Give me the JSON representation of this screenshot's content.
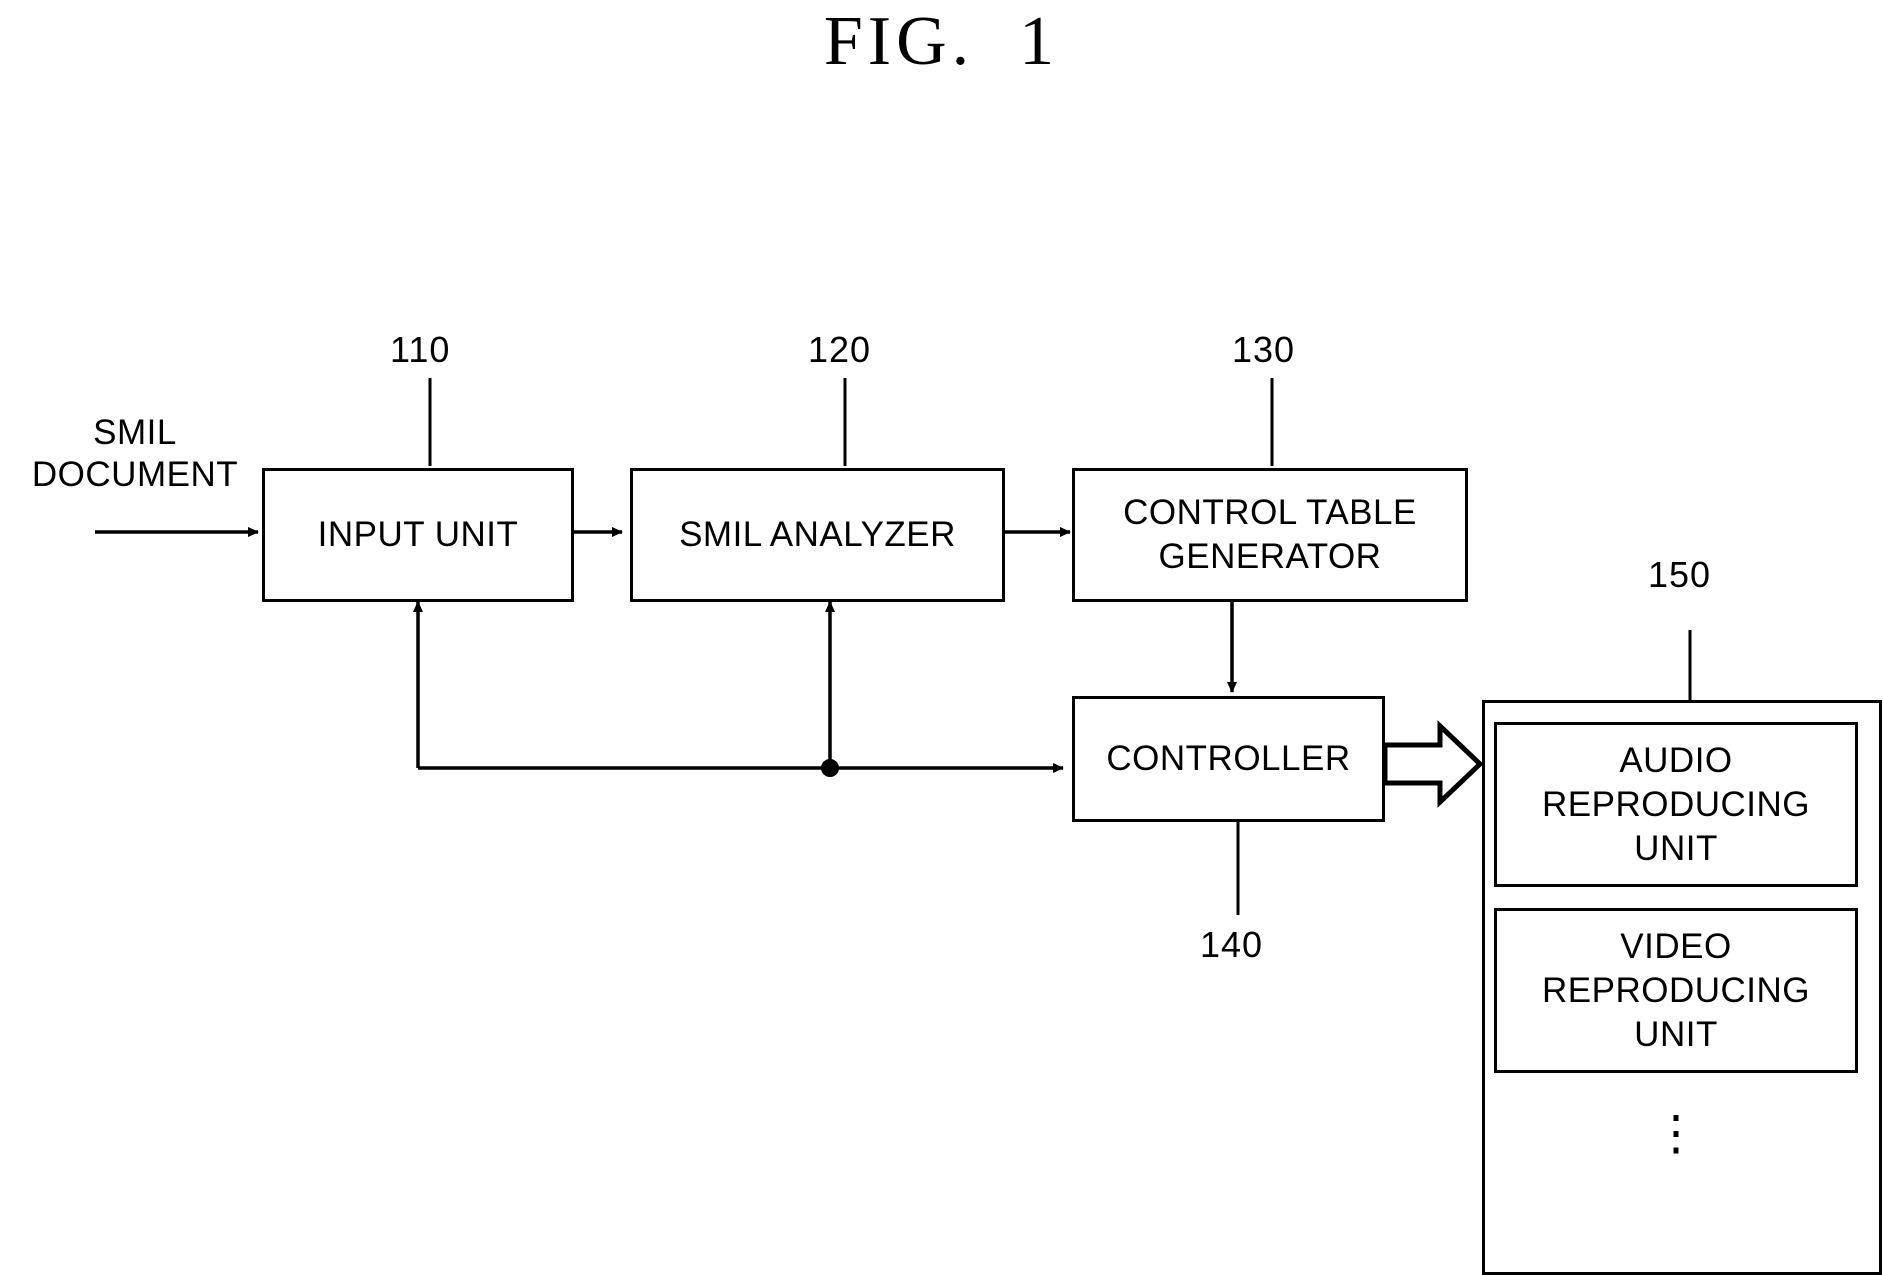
{
  "figure": {
    "title": "FIG.  1",
    "type": "patent-block-diagram"
  },
  "labels": {
    "input_source": "SMIL\nDOCUMENT"
  },
  "blocks": [
    {
      "id": "input-unit",
      "label": "INPUT UNIT",
      "ref": "110"
    },
    {
      "id": "smil-analyzer",
      "label": "SMIL ANALYZER",
      "ref": "120"
    },
    {
      "id": "control-table-gen",
      "label": "CONTROL TABLE\nGENERATOR",
      "ref": "130"
    },
    {
      "id": "controller",
      "label": "CONTROLLER",
      "ref": "140"
    },
    {
      "id": "reproducing-group",
      "label": "",
      "ref": "150"
    },
    {
      "id": "audio-unit",
      "label": "AUDIO\nREPRODUCING\nUNIT",
      "ref": ""
    },
    {
      "id": "video-unit",
      "label": "VIDEO\nREPRODUCING\nUNIT",
      "ref": ""
    }
  ],
  "refs": {
    "input_unit": "110",
    "smil_analyzer": "120",
    "control_table_generator": "130",
    "controller": "140",
    "reproducing_group": "150"
  },
  "block_labels": {
    "input_unit": "INPUT UNIT",
    "smil_analyzer": "SMIL ANALYZER",
    "control_table_generator": "CONTROL TABLE\nGENERATOR",
    "controller": "CONTROLLER",
    "audio_reproducing_unit": "AUDIO\nREPRODUCING\nUNIT",
    "video_reproducing_unit": "VIDEO\nREPRODUCING\nUNIT",
    "more_units": "⋮"
  },
  "colors": {
    "stroke": "#000000",
    "background": "#ffffff"
  },
  "connections": [
    {
      "from": "smil-document",
      "to": "input-unit",
      "style": "solid-arrow"
    },
    {
      "from": "input-unit",
      "to": "smil-analyzer",
      "style": "solid-arrow"
    },
    {
      "from": "smil-analyzer",
      "to": "control-table-gen",
      "style": "solid-arrow"
    },
    {
      "from": "control-table-gen",
      "to": "controller",
      "style": "double-arrow"
    },
    {
      "from": "feedback-bus",
      "to": "controller",
      "style": "solid-arrow"
    },
    {
      "from": "feedback-bus",
      "to": "input-unit",
      "style": "solid-arrow"
    },
    {
      "from": "feedback-bus",
      "to": "smil-analyzer",
      "style": "solid-arrow"
    },
    {
      "from": "controller",
      "to": "reproducing-group",
      "style": "block-arrow"
    }
  ]
}
